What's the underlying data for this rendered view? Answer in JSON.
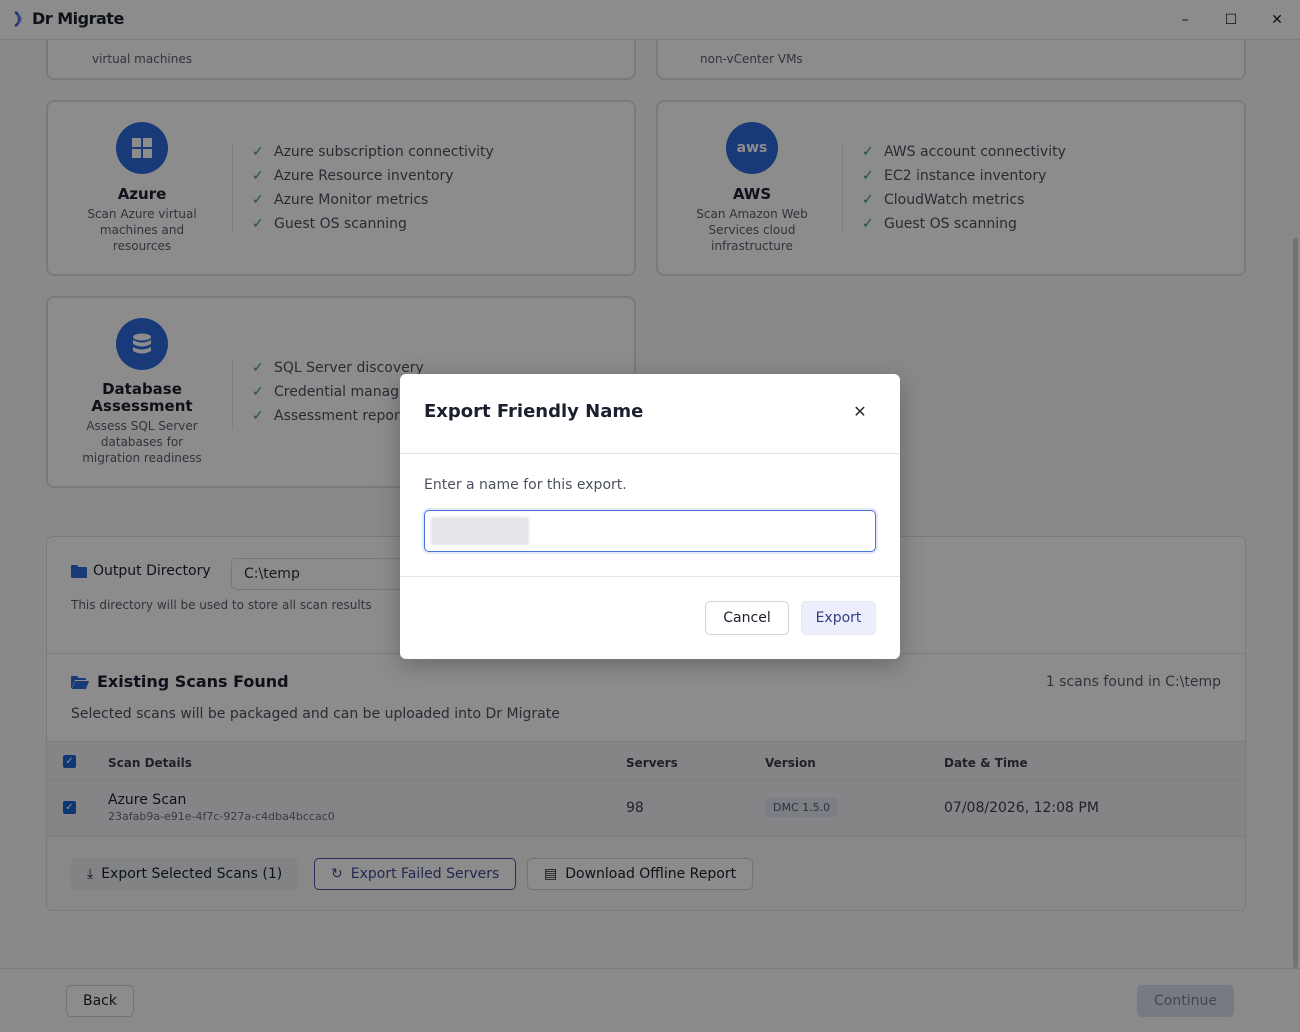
{
  "app": {
    "title": "Dr Migrate",
    "minimize": "–",
    "maximize": "☐",
    "close": "✕"
  },
  "top_cards": [
    {
      "desc_fragment": "virtual machines"
    },
    {
      "desc_fragment": "non-vCenter VMs"
    }
  ],
  "cards": {
    "azure": {
      "title": "Azure",
      "desc": "Scan Azure virtual machines and resources",
      "features": [
        "Azure subscription connectivity",
        "Azure Resource inventory",
        "Azure Monitor metrics",
        "Guest OS scanning"
      ]
    },
    "aws": {
      "title": "AWS",
      "icon_text": "aws",
      "desc": "Scan Amazon Web Services cloud infrastructure",
      "features": [
        "AWS account connectivity",
        "EC2 instance inventory",
        "CloudWatch metrics",
        "Guest OS scanning"
      ]
    },
    "database": {
      "title": "Database Assessment",
      "desc": "Assess SQL Server databases for migration readiness",
      "features": [
        "SQL Server discovery",
        "Credential manag",
        "Assessment repor"
      ]
    }
  },
  "output": {
    "label": "Output Directory",
    "value": "C:\\temp",
    "help": "This directory will be used to store all scan results"
  },
  "scans": {
    "title": "Existing Scans Found",
    "count_text": "1 scans found in C:\\temp",
    "subtitle": "Selected scans will be packaged and can be uploaded into Dr Migrate",
    "columns": [
      "Scan Details",
      "Servers",
      "Version",
      "Date & Time"
    ],
    "rows": [
      {
        "name": "Azure Scan",
        "id": "23afab9a-e91e-4f7c-927a-c4dba4bccac0",
        "servers": "98",
        "version": "DMC 1.5.0",
        "datetime": "07/08/2026, 12:08 PM"
      }
    ]
  },
  "actions": {
    "export_selected": "Export Selected Scans (1)",
    "export_failed": "Export Failed Servers",
    "download_report": "Download Offline Report"
  },
  "footer": {
    "back": "Back",
    "continue": "Continue"
  },
  "modal": {
    "title": "Export Friendly Name",
    "close": "✕",
    "prompt": "Enter a name for this export.",
    "cancel": "Cancel",
    "export": "Export"
  },
  "colors": {
    "accent": "#2f6bdc",
    "check": "#2e9e63",
    "overlay": "rgba(0,0,0,0.45)"
  }
}
